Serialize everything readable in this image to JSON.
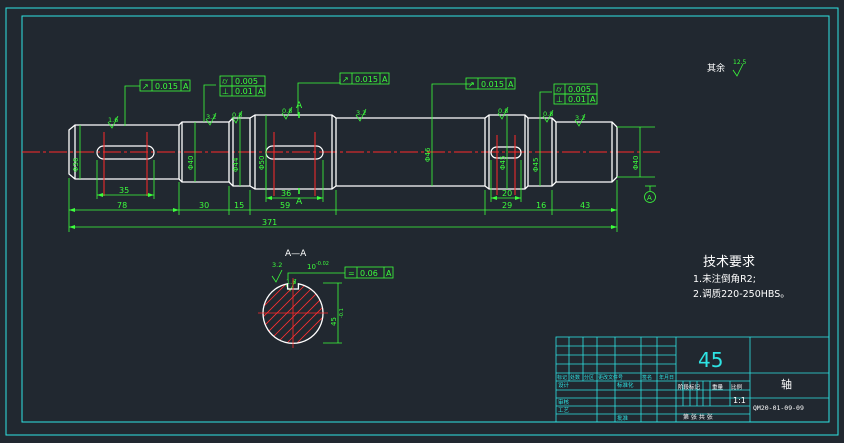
{
  "drawing": {
    "finish_note": {
      "label": "其余",
      "value": "12.5"
    },
    "tech_requirements": {
      "title": "技术要求",
      "items": [
        "1.未注倒角R2;",
        "2.调质220-250HBS。"
      ]
    },
    "section_label": "A—A",
    "section_marks": [
      "A",
      "A"
    ],
    "datum": "A",
    "gdt": [
      {
        "symbol": "↗",
        "tolerance": "0.015",
        "datum": "A"
      },
      {
        "symbol": "⌭",
        "tolerance": "0.005",
        "datum": ""
      },
      {
        "symbol": "⊥",
        "tolerance": "0.01",
        "datum": "A"
      },
      {
        "symbol": "↗",
        "tolerance": "0.015",
        "datum": "A"
      },
      {
        "symbol": "↗",
        "tolerance": "0.015",
        "datum": "A"
      },
      {
        "symbol": "⌭",
        "tolerance": "0.005",
        "datum": ""
      },
      {
        "symbol": "⊥",
        "tolerance": "0.01",
        "datum": "A"
      },
      {
        "symbol": "=",
        "tolerance": "0.06",
        "datum": "A"
      }
    ],
    "roughness": [
      "1.6",
      "3.2",
      "0.8",
      "0.8",
      "3.2",
      "0.8",
      "0.8",
      "3.2",
      "1.6",
      "3.2"
    ],
    "diameters": [
      "Φ36",
      "Φ40",
      "Φ44",
      "Φ50",
      "Φ46",
      "Φ45",
      "Φ45",
      "Φ40"
    ],
    "small_dims": [
      "35",
      "36",
      "20"
    ],
    "lengths": [
      "78",
      "30",
      "15",
      "59",
      "29",
      "16",
      "43"
    ],
    "overall_length": "371",
    "section_dims": {
      "keyway_width": "10",
      "keyway_tol": "-0.02",
      "depth": "45",
      "depth_tol": "-0.1",
      "roughness_a": "3.2",
      "roughness_b": "1.6"
    }
  },
  "title_block": {
    "material": "45",
    "part_name": "轴",
    "scale": "1:1",
    "drawing_no": "QM20-01-09-09",
    "stage_label": "阶段标记",
    "weight_label": "重量",
    "scale_label": "比例",
    "sheet_text": "第 张  共 张",
    "row_headers": [
      "标记",
      "处数",
      "分区",
      "更改文件号",
      "签名",
      "年月日"
    ],
    "roles": [
      "设计",
      "审核",
      "工艺"
    ],
    "std_label": "标准化",
    "approve_label": "批准"
  },
  "colors": {
    "bg": "#212830",
    "frame": "#2ee3e3",
    "part": "#ffffff",
    "dim": "#3cff3c",
    "center": "#ff2a2a",
    "hatch": "#ff3030",
    "tb_text": "#2ee3e3"
  }
}
